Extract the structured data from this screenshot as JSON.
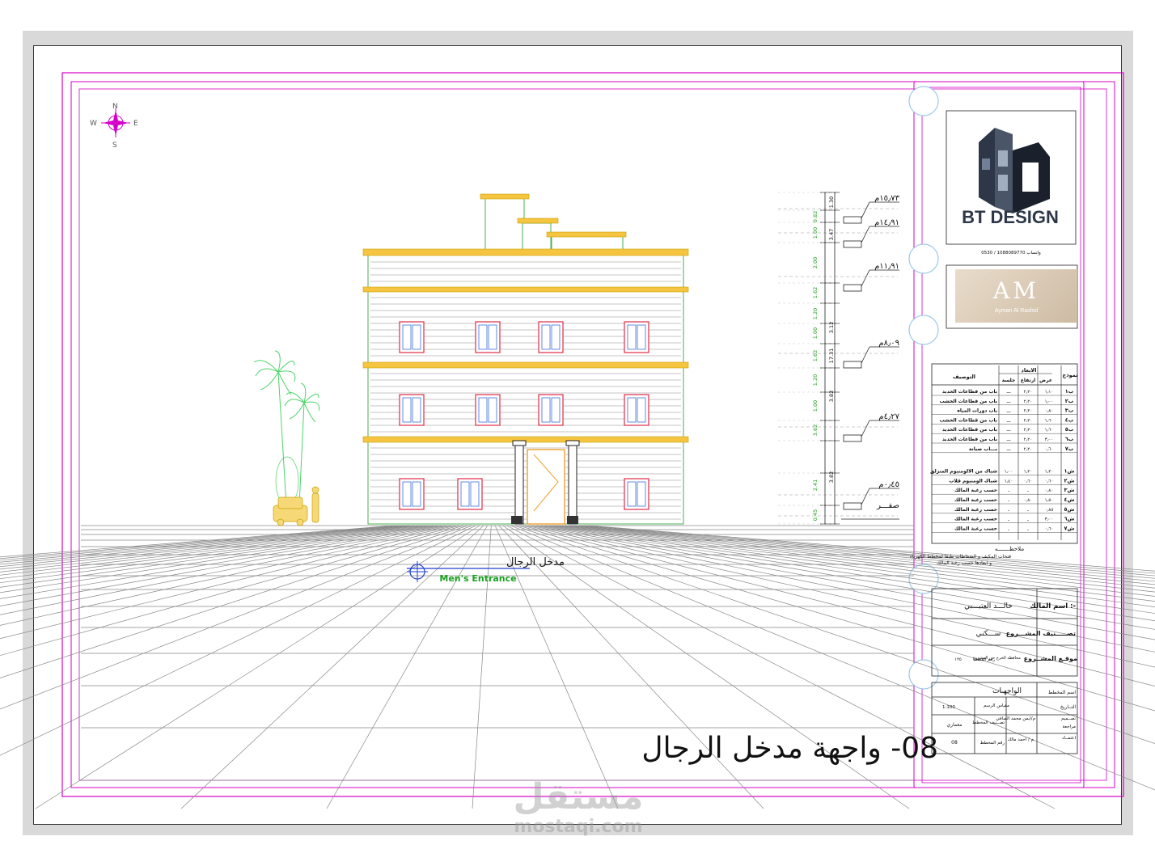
{
  "compass": {
    "n": "N",
    "s": "S",
    "e": "E",
    "w": "W"
  },
  "logo": {
    "brand": "BT DESIGN",
    "phone": "0530 / 1088089770 واتساب"
  },
  "logo2": {
    "monogram": "AM",
    "tagline": "Ayman Al Rashid"
  },
  "levels": [
    {
      "label": "١٥٫٧٣م"
    },
    {
      "label": "١٤٫٩١م"
    },
    {
      "label": "١١٫٩١م"
    },
    {
      "label": "٨٫٠٩م"
    },
    {
      "label": "٤٫٢٧م"
    },
    {
      "label": "٠٫٤٥م"
    },
    {
      "label": "صفـــر"
    }
  ],
  "dimensions": {
    "green": [
      "0.82",
      "1.00",
      "2.00",
      "1.62",
      "1.20",
      "1.00",
      "1.62",
      "1.20",
      "1.00",
      "3.62",
      "2.41",
      "0.45"
    ],
    "black": [
      "1.30",
      "3.47",
      "3.12",
      "17.31",
      "3.82",
      "3.82"
    ]
  },
  "entrance": {
    "ar": "مدخل الرجال",
    "en": "Men's Entrance"
  },
  "drawing_title": "08- واجهة مدخل الرجال",
  "schedule": {
    "headers": {
      "model": "نموذج",
      "dims": "الابعاد",
      "width": "عرض",
      "height": "ارتفاع",
      "sill": "جلسة",
      "desc": "التوصيف"
    },
    "rows": [
      {
        "model": "ب١",
        "width": "١٫١٠",
        "height": "٢٫٢٠",
        "sill": "ـــ",
        "desc": "باب من قطاعات الحديد"
      },
      {
        "model": "ب٢",
        "width": "١٫٠٠",
        "height": "٢٫٢٠",
        "sill": "ـــ",
        "desc": "باب من قطاعات الخشب"
      },
      {
        "model": "ب٣",
        "width": "٠٫٨٠",
        "height": "٢٫٢٠",
        "sill": "ـــ",
        "desc": "باب دورات المياه"
      },
      {
        "model": "ب٤",
        "width": "١٫٦٠",
        "height": "٢٫٢٠",
        "sill": "ـــ",
        "desc": "باب من قطاعات الخشب"
      },
      {
        "model": "ب٥",
        "width": "١٫٦٠",
        "height": "٢٫٢٠",
        "sill": "ـــ",
        "desc": "باب من قطاعات الحديد"
      },
      {
        "model": "ب٦",
        "width": "٣٫٠٠",
        "height": "٢٫٢٠",
        "sill": "ـــ",
        "desc": "باب من قطاعات الحديد"
      },
      {
        "model": "ب٧",
        "width": "٠٫٦٠",
        "height": "٢٫٢٠",
        "sill": "ـــ",
        "desc": "بـــاب صيانة"
      },
      {
        "model": "ش١",
        "width": "١٫٢٠",
        "height": "١٫٢٠",
        "sill": "١٫٠٠",
        "desc": "شباك من الالومنيوم المنزلق"
      },
      {
        "model": "ش٢",
        "width": "٠٫٦٠",
        "height": "٠٫٦٠",
        "sill": "١٫٤٠",
        "desc": "شباك الومنيوم قلاب"
      },
      {
        "model": "ش٣",
        "width": "٠٫٨٠",
        "height": "ـ",
        "sill": "ـ",
        "desc": "حسب رغبة المالك"
      },
      {
        "model": "ش٤",
        "width": "١٫٥٠",
        "height": "٠٫٨٠",
        "sill": "ـ",
        "desc": "حسب رغبة المالك"
      },
      {
        "model": "ش٥",
        "width": "٠٫٨٥",
        "height": "ـ",
        "sill": "ـ",
        "desc": "حسب رغبة المالك"
      },
      {
        "model": "ش٦",
        "width": "٣٫٠٠",
        "height": "ـ",
        "sill": "ـ",
        "desc": "حسب رغبة المالك"
      },
      {
        "model": "ش٧",
        "width": "٠٫٦٠",
        "height": "ـ",
        "sill": "ـ",
        "desc": "حسب رغبة المالك"
      }
    ]
  },
  "notes": {
    "title": "ملاحظـــــــه",
    "line1": "فتحات المكيف و الشفاطات طبقا لمخطط الكهرباء",
    "line2": "و ابعادها حسب رغبة المالك"
  },
  "titleblock": {
    "owner_label": "اسم المالك :-",
    "owner_value": "خالـــد العتيـــبي",
    "class_label": "تصـــــنيف المشـــروع",
    "class_value": "ســـكني",
    "location_label": "موقـع المشــروع",
    "location_note": "محافظة الخرج حي المشروع",
    "plot_label": "رقم القطعة",
    "plot_value": "١٢٥",
    "plan_label": "اسم المخطط",
    "plan_value": "الواجهـات",
    "scale_label": "مقياس الرسم",
    "scale_value": "1:100",
    "date_label": "التــاريخ",
    "design_label": "تصــميم",
    "design_value": "م/ايمن محمد الصافي",
    "review_label": "مراجعة",
    "approve_label": "اعتمــاد",
    "approve_value": "م / احمد مالك",
    "plan_class_label": "تصــنيف المخطط",
    "plan_class_value": "معماري",
    "plan_no_label": "رقم المخطط",
    "plan_no_value": "08"
  },
  "watermark": {
    "ar": "مستقل",
    "en": "mostaqi.com"
  }
}
